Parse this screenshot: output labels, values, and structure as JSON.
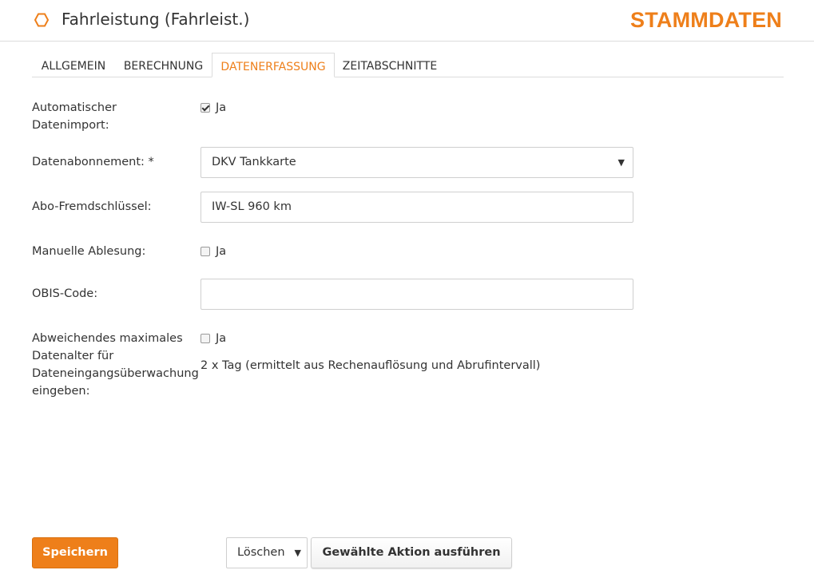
{
  "header": {
    "title": "Fahrleistung (Fahrleist.)",
    "brand": "STAMMDATEN",
    "icon": "hexagon-icon",
    "accent_color": "#ee7f1a"
  },
  "tabs": [
    {
      "label": "ALLGEMEIN",
      "active": false
    },
    {
      "label": "BERECHNUNG",
      "active": false
    },
    {
      "label": "DATENERFASSUNG",
      "active": true
    },
    {
      "label": "ZEITABSCHNITTE",
      "active": false
    }
  ],
  "form": {
    "auto_import": {
      "label_line1": "Automatischer",
      "label_line2": "Datenimport:",
      "checkbox_label": "Ja",
      "checked": true
    },
    "subscription": {
      "label": "Datenabonnement: *",
      "value": "DKV Tankkarte"
    },
    "foreign_key": {
      "label": "Abo-Fremdschlüssel:",
      "value": "IW-SL 960 km"
    },
    "manual_reading": {
      "label": "Manuelle Ablesung:",
      "checkbox_label": "Ja",
      "checked": false
    },
    "obis_code": {
      "label": "OBIS-Code:",
      "value": ""
    },
    "max_data_age": {
      "label_line1": "Abweichendes maximales",
      "label_line2": "Datenalter für",
      "label_line3": "Dateneingangsüberwachung",
      "label_line4": "eingeben:",
      "checkbox_label": "Ja",
      "checked": false,
      "info": "2 x Tag (ermittelt aus Rechenauflösung und Abrufintervall)"
    }
  },
  "footer": {
    "save_label": "Speichern",
    "action_select_value": "Löschen",
    "run_action_label": "Gewählte Aktion ausführen"
  }
}
